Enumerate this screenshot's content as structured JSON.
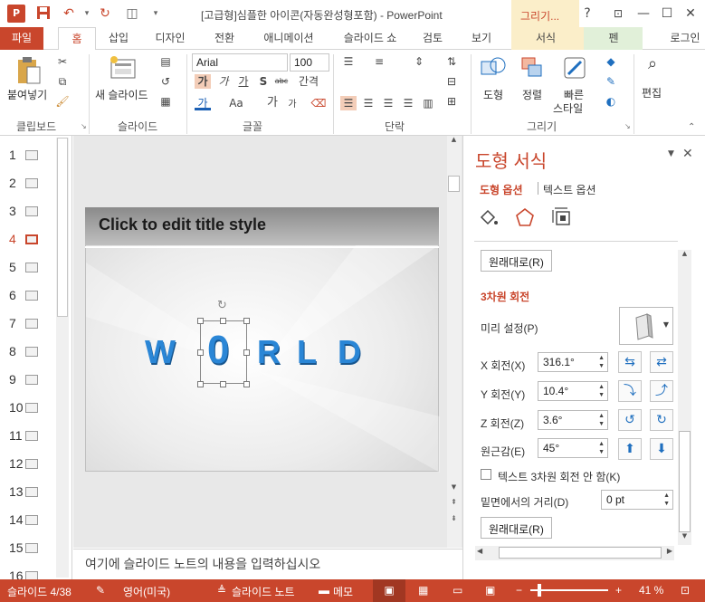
{
  "window": {
    "title": "[고급형]심플한 아이콘(자동완성형포함) - PowerPoint",
    "app_logo": "P",
    "context_tab_title": "그리기...",
    "help": "?",
    "minimize": "—",
    "maximize": "☐",
    "close": "✕"
  },
  "tabs": [
    "파일",
    "홈",
    "삽입",
    "디자인",
    "전환",
    "애니메이션",
    "슬라이드 쇼",
    "검토",
    "보기",
    "서식",
    "펜",
    "로그인"
  ],
  "ribbon": {
    "clipboard": {
      "paste": "붙여넣기",
      "group": "클립보드"
    },
    "slides": {
      "new_slide": "새 슬라이드",
      "group": "슬라이드"
    },
    "font": {
      "name": "Arial",
      "size": "100",
      "group": "글꼴",
      "bold": "가",
      "italic": "가",
      "underline": "가",
      "strike": "S",
      "shadow": "abc",
      "spacing": "간격",
      "color": "가",
      "case": "Aa",
      "grow": "가",
      "shrink": "가"
    },
    "paragraph": {
      "group": "단락"
    },
    "drawing": {
      "shape": "도형",
      "arrange": "정렬",
      "quick_style_1": "빠른",
      "quick_style_2": "스타일",
      "group": "그리기"
    },
    "editing": {
      "edit": "편집"
    }
  },
  "thumbnails": {
    "numbers": [
      "1",
      "2",
      "3",
      "4",
      "5",
      "6",
      "7",
      "8",
      "9",
      "10",
      "11",
      "12",
      "13",
      "14",
      "15",
      "16"
    ],
    "selected": "4"
  },
  "slide": {
    "title": "Click to edit title style",
    "letters": [
      "W",
      "0",
      "R",
      "L",
      "D"
    ]
  },
  "notes": {
    "placeholder": "여기에 슬라이드 노트의 내용을 입력하십시오"
  },
  "format_pane": {
    "title": "도형 서식",
    "tab_shape": "도형 옵션",
    "tab_text": "텍스트 옵션",
    "reset_top": "원래대로(R)",
    "section": "3차원 회전",
    "preset_label": "미리 설정(P)",
    "x_label": "X 회전(X)",
    "x_value": "316.1°",
    "y_label": "Y 회전(Y)",
    "y_value": "10.4°",
    "z_label": "Z 회전(Z)",
    "z_value": "3.6°",
    "persp_label": "원근감(E)",
    "persp_value": "45°",
    "keep_flat_label": "텍스트 3차원 회전 안 함(K)",
    "keep_flat_checked": false,
    "distance_label": "밑면에서의 거리(D)",
    "distance_value": "0 pt",
    "reset_bottom": "원래대로(R)"
  },
  "status": {
    "slide_info": "슬라이드 4/38",
    "language": "영어(미국)",
    "notes_btn": "슬라이드 노트",
    "comments_btn": "메모",
    "zoom": "41 %"
  },
  "colors": {
    "accent": "#c9462c",
    "word": "#2a86d6"
  }
}
